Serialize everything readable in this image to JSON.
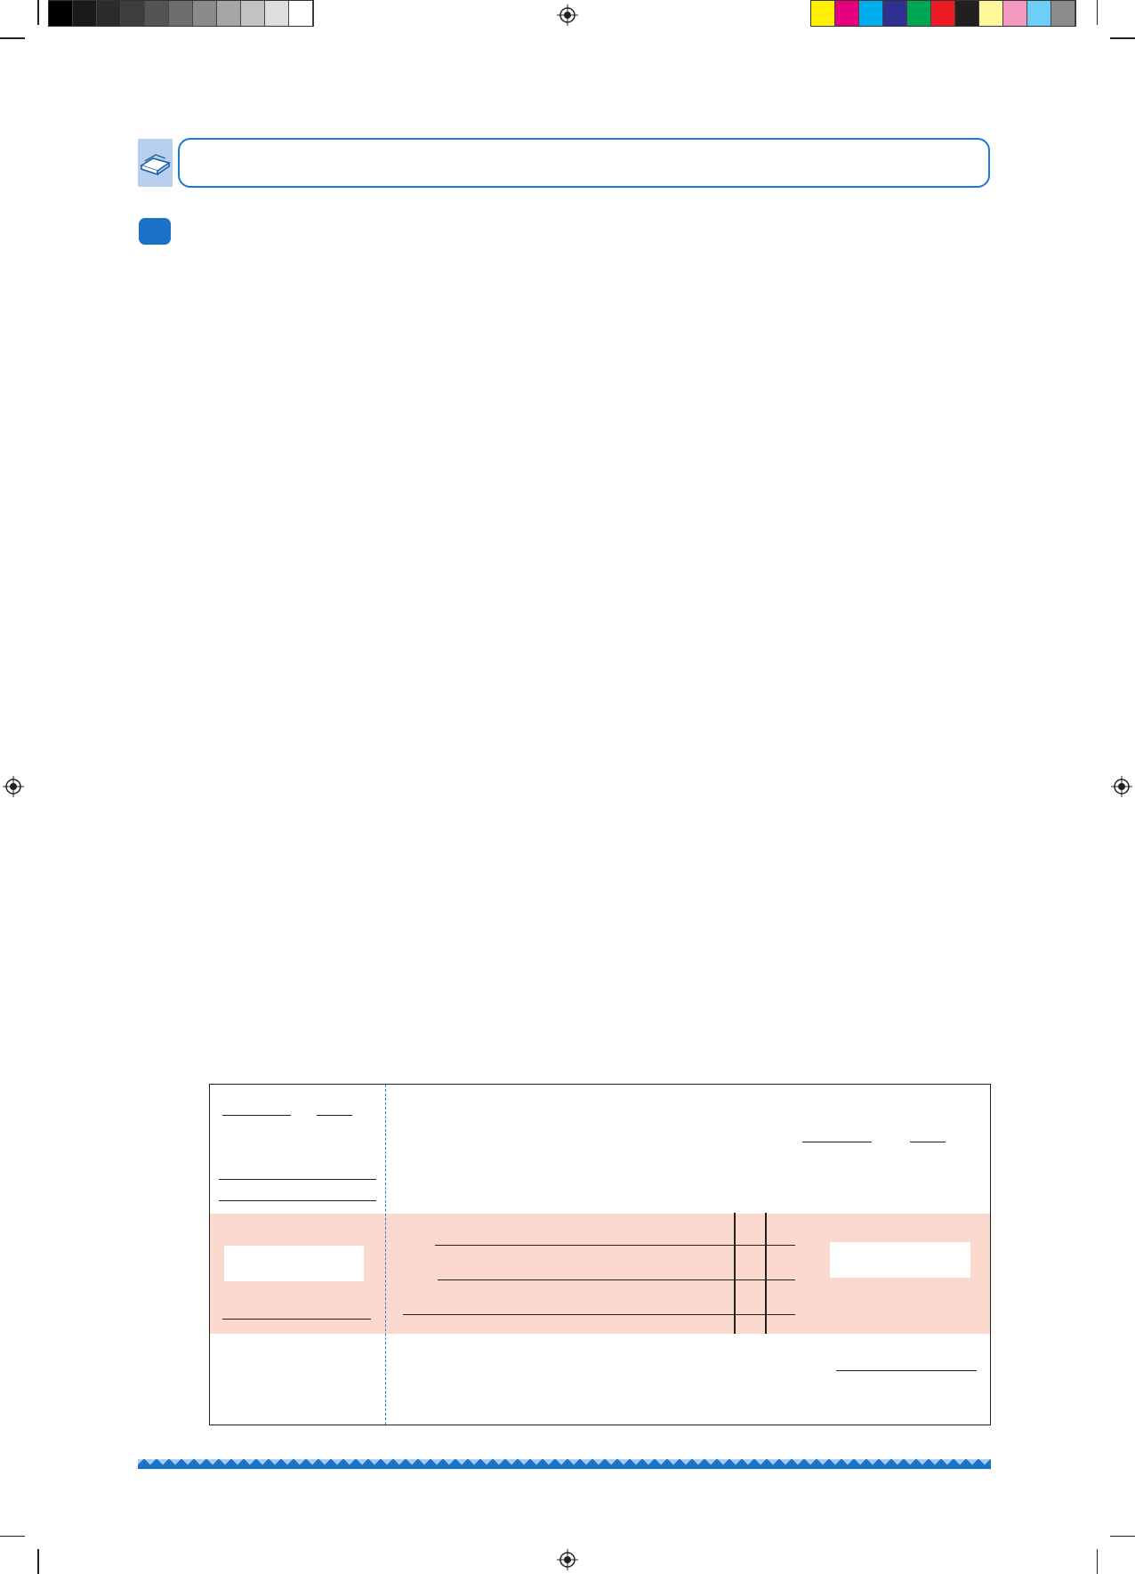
{
  "colors": {
    "grayscale_bar": [
      "#000000",
      "#1a1a1a",
      "#2b2b2b",
      "#3d3d3d",
      "#545454",
      "#6e6e6e",
      "#8a8a8a",
      "#a6a6a6",
      "#c2c2c2",
      "#dedede",
      "#ffffff"
    ],
    "cmyk_bar": [
      "#ffef00",
      "#e6007e",
      "#00aeef",
      "#2e3192",
      "#00a651",
      "#ed1c24",
      "#231f20",
      "#fff799",
      "#f49ac1",
      "#6dcff6",
      "#8c8c8c"
    ],
    "accent_blue": "#1a73c7",
    "form_highlight": "#fbd9cf"
  },
  "header": {
    "icon": "open-book-icon",
    "title": ""
  },
  "section": {
    "bullet_icon": "section-bullet-icon"
  },
  "form": {
    "left_panel": {},
    "right_panel": {}
  },
  "footer": {
    "decoration": "triangle-pattern-band"
  }
}
